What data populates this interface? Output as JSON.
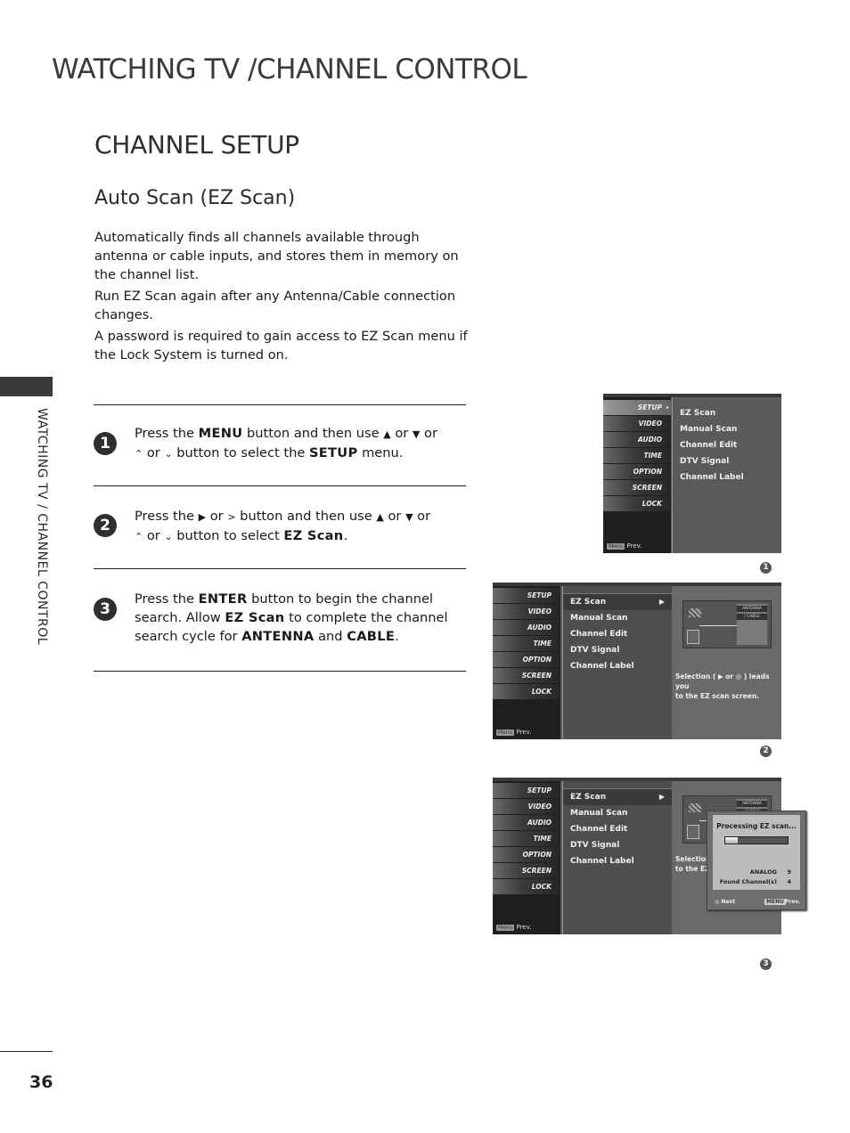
{
  "header": {
    "main_title": "WATCHING TV /CHANNEL CONTROL",
    "section_title": "CHANNEL SETUP",
    "sub_title": "Auto Scan (EZ Scan)"
  },
  "intro": [
    "Automatically finds all channels available through antenna or cable inputs, and stores them in memory on the channel list.",
    "Run EZ Scan again after any Antenna/Cable connection changes.",
    "A password is required to gain access to EZ Scan menu if the Lock System is turned on."
  ],
  "side_tab": {
    "label": "WATCHING TV / CHANNEL CONTROL"
  },
  "page_number": "36",
  "steps": [
    {
      "num": "1",
      "t1": "Press the ",
      "k1": "MENU",
      "t2": " button and then use ",
      "g1": "▲",
      "t3": " or ",
      "g2": "▼",
      "t4": "  or",
      "g3": "⌃",
      "t5": " or ",
      "g4": "⌄",
      "t6": " button to select the ",
      "k2": "SETUP",
      "t7": " menu."
    },
    {
      "num": "2",
      "t1": "Press the ",
      "g0": "▶",
      "t1b": "  or  ",
      "g0b": ">",
      "t2": "  button and then use ",
      "g1": "▲",
      "t3": " or ",
      "g2": "▼",
      "t4": "  or",
      "g3": "⌃",
      "t5": " or ",
      "g4": "⌄",
      "t6": " button to select ",
      "k2": "EZ Scan",
      "t7": "."
    },
    {
      "num": "3",
      "t1": "Press the ",
      "k1": "ENTER",
      "t2": " button to begin the channel search. Allow ",
      "k2": "EZ Scan",
      "t3": " to complete the channel search cycle for ",
      "k3": "ANTENNA",
      "t4": " and ",
      "k4": "CABLE",
      "t5": "."
    }
  ],
  "menu_tabs": [
    "SETUP",
    "VIDEO",
    "AUDIO",
    "TIME",
    "OPTION",
    "SCREEN",
    "LOCK"
  ],
  "setup_items": [
    "EZ Scan",
    "Manual Scan",
    "Channel Edit",
    "DTV Signal",
    "Channel Label"
  ],
  "prev_label": "Prev.",
  "menu_chip": "Menu",
  "screens": [
    {
      "badge": "1",
      "active_tab": "SETUP"
    },
    {
      "badge": "2",
      "selected_item": "EZ Scan",
      "illustration_labels": [
        "ANTENNA",
        "/ CABLE"
      ],
      "info_line1": "Selection ( ▶ or ◎ )  leads you",
      "info_line2": "to the EZ scan screen."
    },
    {
      "badge": "3",
      "selected_item": "EZ Scan",
      "info_line1": "Selection",
      "info_line2": "to the EZ"
    }
  ],
  "popup": {
    "title": "Processing EZ scan...",
    "progress_fraction": 0.2,
    "rows": [
      {
        "label": "ANALOG",
        "value": "9"
      },
      {
        "label": "Found Channel(s)",
        "value": "4"
      }
    ],
    "next_label": "◎ Next",
    "menu_label": "MENU",
    "prev_label": "Prev."
  }
}
